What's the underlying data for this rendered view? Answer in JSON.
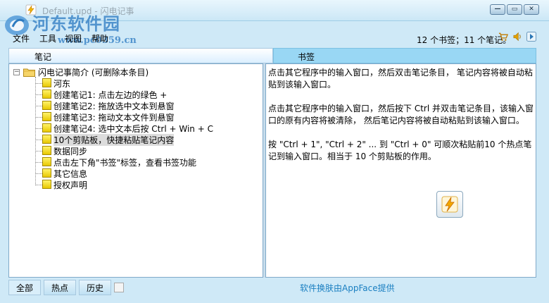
{
  "window": {
    "title": "Default.upd - 闪电记事",
    "buttons": {
      "minimize": "—",
      "restore": "▭",
      "close": "✕"
    }
  },
  "watermark": {
    "title": "河东软件园",
    "url": "www.pc0359.cn"
  },
  "menu": {
    "items": [
      "文件",
      "工具",
      "视图",
      "帮助"
    ]
  },
  "status": {
    "text": "12 个书签；11 个笔记。",
    "icons": [
      "cart-icon",
      "speaker-icon",
      "next-icon"
    ]
  },
  "panels": {
    "notes_header": "笔记",
    "bookmarks_header": "书签"
  },
  "tree": {
    "root": {
      "label": "闪电记事简介 (可删除本条目)",
      "expanded": true,
      "expander": "−"
    },
    "items": [
      {
        "label": "河东",
        "selected": false
      },
      {
        "label": "创建笔记1: 点击左边的绿色 +",
        "selected": false
      },
      {
        "label": "创建笔记2: 拖放选中文本到悬窗",
        "selected": false
      },
      {
        "label": "创建笔记3: 拖动文本文件到悬窗",
        "selected": false
      },
      {
        "label": "创建笔记4: 选中文本后按 Ctrl + Win + C",
        "selected": false
      },
      {
        "label": "10个剪贴板，快捷粘贴笔记内容",
        "selected": true
      },
      {
        "label": "数据同步",
        "selected": false
      },
      {
        "label": "点击左下角\"书签\"标签，查看书签功能",
        "selected": false
      },
      {
        "label": "其它信息",
        "selected": false
      },
      {
        "label": "授权声明",
        "selected": false
      }
    ]
  },
  "content": {
    "paragraphs": [
      "点击其它程序中的输入窗口，然后双击笔记条目， 笔记内容将被自动粘贴到该输入窗口。",
      "点击其它程序中的输入窗口，然后按下 Ctrl 并双击笔记条目，该输入窗口的原有内容将被清除， 然后笔记内容将被自动粘贴到该输入窗口。",
      "按 \"Ctrl + 1\", \"Ctrl + 2\" ... 到 \"Ctrl + 0\" 可顺次粘贴前10 个热点笔记到输入窗口。相当于 10 个剪贴板的作用。"
    ],
    "flash_icon": "lightning-icon"
  },
  "bottom": {
    "tabs": [
      "全部",
      "热点",
      "历史"
    ],
    "active_tab": "全部",
    "footer": "软件换肤由AppFace提供"
  },
  "colors": {
    "background": "#cfe9f7",
    "bookmark_header": "#99d7f4",
    "link": "#1a7fc1",
    "note_icon": "#f5e02a"
  }
}
